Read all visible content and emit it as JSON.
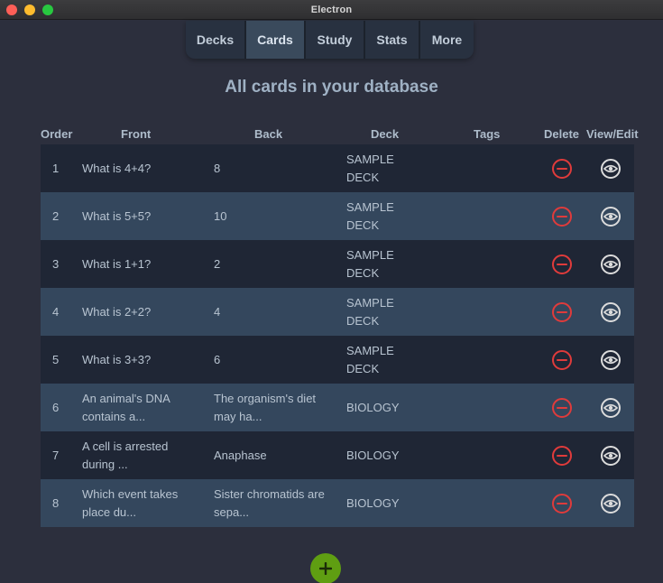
{
  "window": {
    "title": "Electron"
  },
  "nav": {
    "tabs": [
      {
        "label": "Decks",
        "active": false
      },
      {
        "label": "Cards",
        "active": true
      },
      {
        "label": "Study",
        "active": false
      },
      {
        "label": "Stats",
        "active": false
      },
      {
        "label": "More",
        "active": false
      }
    ]
  },
  "page": {
    "title": "All cards in your database"
  },
  "table": {
    "headers": {
      "order": "Order",
      "front": "Front",
      "back": "Back",
      "deck": "Deck",
      "tags": "Tags",
      "delete": "Delete",
      "view_edit": "View/Edit"
    },
    "rows": [
      {
        "order": "1",
        "front": "What is 4+4?",
        "back": "8",
        "deck": "SAMPLE DECK",
        "tags": ""
      },
      {
        "order": "2",
        "front": "What is 5+5?",
        "back": "10",
        "deck": "SAMPLE DECK",
        "tags": ""
      },
      {
        "order": "3",
        "front": "What is 1+1?",
        "back": "2",
        "deck": "SAMPLE DECK",
        "tags": ""
      },
      {
        "order": "4",
        "front": "What is 2+2?",
        "back": "4",
        "deck": "SAMPLE DECK",
        "tags": ""
      },
      {
        "order": "5",
        "front": "What is 3+3?",
        "back": "6",
        "deck": "SAMPLE DECK",
        "tags": ""
      },
      {
        "order": "6",
        "front": "An animal's DNA contains a...",
        "back": "The organism's diet may ha...",
        "deck": "BIOLOGY",
        "tags": ""
      },
      {
        "order": "7",
        "front": "A cell is arrested during ...",
        "back": "Anaphase",
        "deck": "BIOLOGY",
        "tags": ""
      },
      {
        "order": "8",
        "front": "Which event takes place du...",
        "back": "Sister chromatids are sepa...",
        "deck": "BIOLOGY",
        "tags": ""
      }
    ]
  },
  "icons": {
    "delete": "minus-circle-icon",
    "view": "eye-icon",
    "add": "plus-icon"
  },
  "colors": {
    "accent_delete": "#e03b3b",
    "add_button": "#5f9e12",
    "row_odd": "#1f2635",
    "row_even": "#34475d"
  }
}
